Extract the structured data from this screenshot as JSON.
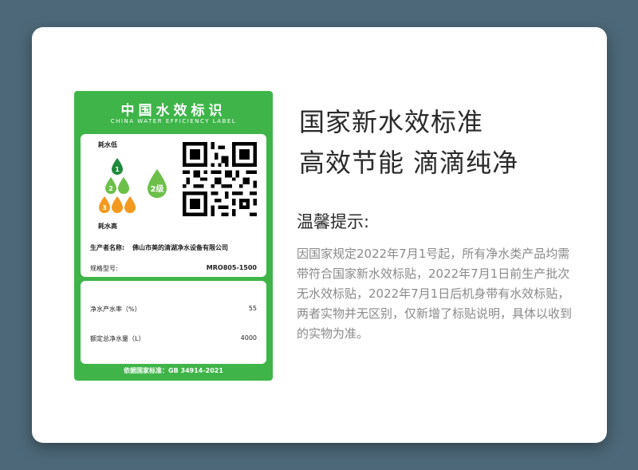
{
  "label": {
    "title": "中国水效标识",
    "subtitle": "CHINA WATER EFFICIENCY LABEL",
    "low_consumption": "耗水低",
    "high_consumption": "耗水高",
    "grade": "2级",
    "drop_numbers": [
      "1",
      "2",
      "3"
    ],
    "manufacturer_label": "生产者名称:",
    "manufacturer_value": "佛山市美的清湖净水设备有限公司",
    "model_label": "规格型号:",
    "model_value": "MRO805-1500",
    "rate_label": "净水产水率（%）",
    "rate_value": "55",
    "total_label": "额定总净水量（L）",
    "total_value": "4000",
    "standard": "依据国家标准：GB 34914-2021",
    "colors": {
      "green": "#3fb549",
      "dark_green": "#1f8a3a",
      "orange": "#f39a1e"
    }
  },
  "headings": {
    "line1": "国家新水效标准",
    "line2": "高效节能  滴滴纯净"
  },
  "tip": {
    "title": "温馨提示:",
    "body": "因国家规定2022年7月1号起，所有净水类产品均需带符合国家新水效标贴，2022年7月1日前生产批次无水效标贴，2022年7月1日后机身带有水效标贴，两者实物并无区别，仅新增了标贴说明，具体以收到的实物为准。"
  }
}
